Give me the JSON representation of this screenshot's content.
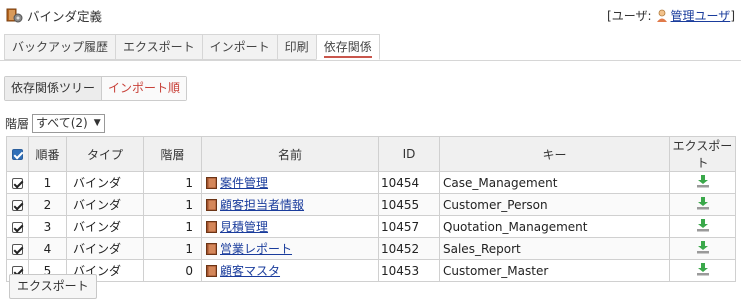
{
  "header": {
    "title": "バインダ定義",
    "user_prefix": "[ユーザ:",
    "user_name": "管理ユーザ",
    "user_suffix": "]"
  },
  "tabs": [
    {
      "label": "バックアップ履歴"
    },
    {
      "label": "エクスポート"
    },
    {
      "label": "インポート"
    },
    {
      "label": "印刷"
    },
    {
      "label": "依存関係",
      "active": true
    }
  ],
  "subtoggle": {
    "tree": "依存関係ツリー",
    "import_order": "インポート順"
  },
  "filter": {
    "label": "階層",
    "selected": "すべて(2)"
  },
  "table": {
    "headers": {
      "no": "順番",
      "type": "タイプ",
      "level": "階層",
      "name": "名前",
      "id": "ID",
      "key": "キー",
      "export": "エクスポート"
    },
    "rows": [
      {
        "no": "1",
        "type": "バインダ",
        "level": "1",
        "name": "案件管理",
        "id": "10454",
        "key": "Case_Management"
      },
      {
        "no": "2",
        "type": "バインダ",
        "level": "1",
        "name": "顧客担当者情報",
        "id": "10455",
        "key": "Customer_Person"
      },
      {
        "no": "3",
        "type": "バインダ",
        "level": "1",
        "name": "見積管理",
        "id": "10457",
        "key": "Quotation_Management"
      },
      {
        "no": "4",
        "type": "バインダ",
        "level": "1",
        "name": "営業レポート",
        "id": "10452",
        "key": "Sales_Report"
      },
      {
        "no": "5",
        "type": "バインダ",
        "level": "0",
        "name": "顧客マスタ",
        "id": "10453",
        "key": "Customer_Master"
      }
    ]
  },
  "footer": {
    "export_button": "エクスポート"
  },
  "colors": {
    "link": "#1a3c9c",
    "accent_red": "#c8423a",
    "export_green": "#3aa84a"
  }
}
